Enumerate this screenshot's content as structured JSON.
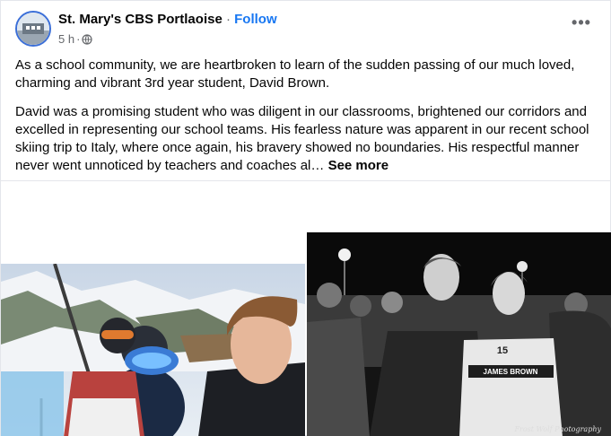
{
  "post": {
    "page_name": "St. Mary's CBS Portlaoise",
    "separator": " · ",
    "follow_label": "Follow",
    "timestamp": "5 h",
    "meta_separator": "·",
    "privacy_icon": "globe-icon",
    "more_icon": "more-horizontal-icon",
    "more_label": "•••",
    "paragraph_1": "As a school community, we are heartbroken to learn of the sudden passing of our much loved, charming and vibrant 3rd year student, David Brown.",
    "paragraph_2": "David was a promising student who was diligent in our classrooms, brightened our corridors and excelled in representing our school teams. His fearless nature was apparent in our recent school skiing trip to Italy, where once again, his bravery showed no boundaries. His respectful manner never went unnoticed by teachers and coaches al…",
    "see_more_label": "See more"
  },
  "photos": {
    "right_jersey_text": "JAMES BROWN",
    "right_jersey_number": "15",
    "right_watermark": "Frost Wolf Photography"
  },
  "colors": {
    "accent": "#1877f2",
    "secondary_text": "#65676b",
    "divider": "#e4e6eb"
  }
}
